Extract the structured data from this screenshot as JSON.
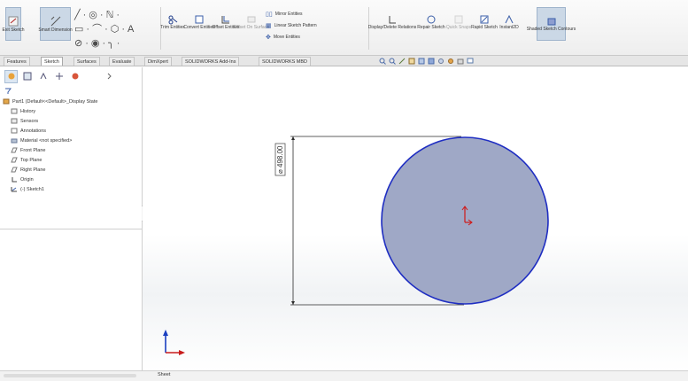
{
  "ribbon": {
    "exit_sketch": "Exit Sketch",
    "smart_dimension": "Smart Dimension",
    "trim_entities": "Trim Entities",
    "convert_entities": "Convert Entities",
    "offset_entities": "Offset Entities",
    "offset_on_surface": "Offset On Surface",
    "mirror_entities": "Mirror Entities",
    "linear_sketch_pattern": "Linear Sketch Pattern",
    "move_entities": "Move Entities",
    "display_delete_relations": "Display/Delete Relations",
    "repair_sketch": "Repair Sketch",
    "quick_snaps": "Quick Snaps",
    "rapid_sketch": "Rapid Sketch",
    "instant2d": "Instant2D",
    "shaded_sketch_contours": "Shaded Sketch Contours"
  },
  "tabs": [
    "Features",
    "Sketch",
    "Surfaces",
    "Evaluate",
    "DimXpert",
    "SOLIDWORKS Add-Ins",
    "SOLIDWORKS MBD"
  ],
  "active_tab": "Sketch",
  "tree": {
    "root": "Part1 (Default<<Default>_Display State",
    "items": [
      "History",
      "Sensors",
      "Annotations",
      "Material <not specified>",
      "Front Plane",
      "Top Plane",
      "Right Plane",
      "Origin",
      "(-) Sketch1"
    ]
  },
  "graphics": {
    "dimension": "⌀ 498.00",
    "sheet_label": "Sheet"
  },
  "colors": {
    "circle_fill": "#9fa8c6",
    "circle_stroke": "#1f2ec2",
    "origin_red": "#d01818",
    "triad_blue": "#1a3fc0",
    "triad_red": "#c81c1c"
  },
  "icons": [
    "exit-sketch-icon",
    "smart-dimension-icon",
    "line-icon",
    "circle-icon",
    "trim-icon",
    "mirror-icon",
    "filter-icon",
    "triad-icon"
  ]
}
